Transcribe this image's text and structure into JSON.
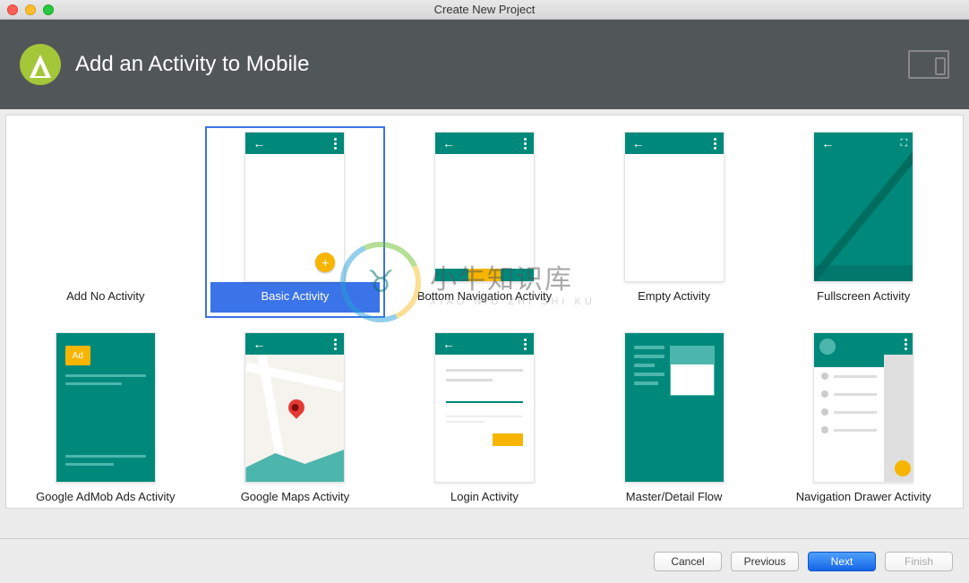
{
  "window": {
    "title": "Create New Project"
  },
  "header": {
    "title": "Add an Activity to Mobile"
  },
  "templates": [
    {
      "label": "Add No Activity",
      "kind": "none"
    },
    {
      "label": "Basic Activity",
      "kind": "basic",
      "selected": true
    },
    {
      "label": "Bottom Navigation Activity",
      "kind": "bottomnav"
    },
    {
      "label": "Empty Activity",
      "kind": "empty"
    },
    {
      "label": "Fullscreen Activity",
      "kind": "fullscreen"
    },
    {
      "label": "Google AdMob Ads Activity",
      "kind": "admob"
    },
    {
      "label": "Google Maps Activity",
      "kind": "maps"
    },
    {
      "label": "Login Activity",
      "kind": "login"
    },
    {
      "label": "Master/Detail Flow",
      "kind": "masterdetail"
    },
    {
      "label": "Navigation Drawer Activity",
      "kind": "navdrawer"
    }
  ],
  "footer": {
    "cancel": "Cancel",
    "previous": "Previous",
    "next": "Next",
    "finish": "Finish"
  },
  "watermark": {
    "main": "小牛知识库",
    "sub": "XIAO NIU ZHI SHI KU"
  },
  "admob_badge": "Ad"
}
